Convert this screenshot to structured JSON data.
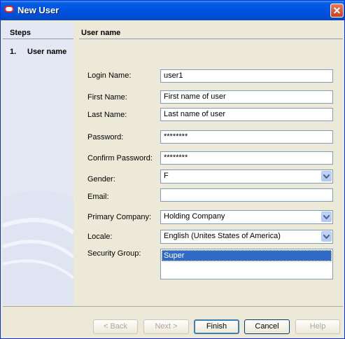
{
  "window": {
    "title": "New User",
    "close_glyph": "✕"
  },
  "steps": {
    "header": "Steps",
    "items": [
      {
        "number": "1.",
        "label": "User name"
      }
    ]
  },
  "content": {
    "header": "User name",
    "fields": {
      "login_name": {
        "label": "Login Name:",
        "value": "user1"
      },
      "first_name": {
        "label": "First Name:",
        "value": "First name of user"
      },
      "last_name": {
        "label": "Last Name:",
        "value": "Last name of user"
      },
      "password": {
        "label": "Password:",
        "value": "********"
      },
      "confirm_password": {
        "label": "Confirm Password:",
        "value": "********"
      },
      "gender": {
        "label": "Gender:",
        "value": "F"
      },
      "email": {
        "label": "Email:",
        "value": ""
      },
      "primary_company": {
        "label": "Primary Company:",
        "value": "Holding Company"
      },
      "locale": {
        "label": "Locale:",
        "value": "English (Unites States of America)"
      },
      "security_group": {
        "label": "Security Group:",
        "selected": "Super"
      }
    }
  },
  "buttons": {
    "back": "< Back",
    "next": "Next >",
    "finish": "Finish",
    "cancel": "Cancel",
    "help": "Help"
  },
  "colors": {
    "title_bar": "#0055e5",
    "selection": "#316ac5",
    "steps_panel": "#e4e8f4"
  }
}
